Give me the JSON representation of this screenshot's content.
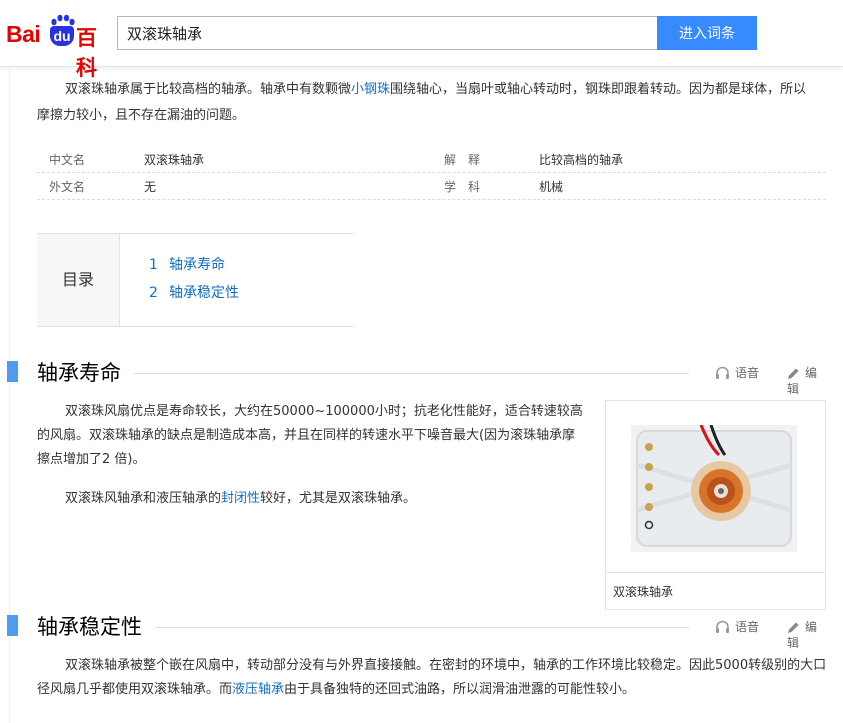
{
  "header": {
    "logo_bai": "Bai",
    "logo_du": "du",
    "logo_baike": "百科",
    "search_value": "双滚珠轴承",
    "search_button": "进入词条"
  },
  "intro": {
    "text_before": "双滚珠轴承属于比较高档的轴承。轴承中有数颗微",
    "link": "小钢珠",
    "text_after": "围绕轴心，当扇叶或轴心转动时，钢珠即跟着转动。因为都是球体，所以摩擦力较小，且不存在漏油的问题。"
  },
  "basic_info": {
    "row1": {
      "k1": "中文名",
      "v1": "双滚珠轴承",
      "k2": "解　释",
      "v2": "比较高档的轴承"
    },
    "row2": {
      "k1": "外文名",
      "v1": "无",
      "k2": "学　科",
      "v2": "机械"
    }
  },
  "catalog": {
    "title": "目录",
    "items": [
      {
        "num": "1",
        "label": "轴承寿命"
      },
      {
        "num": "2",
        "label": "轴承稳定性"
      }
    ]
  },
  "actions": {
    "voice": "语音",
    "edit": "编辑"
  },
  "section1": {
    "title": "轴承寿命",
    "para1": "双滚珠风扇优点是寿命较长，大约在50000~100000小时；抗老化性能好，适合转速较高的风扇。双滚珠轴承的缺点是制造成本高，并且在同样的转速水平下噪音最大(因为滚珠轴承摩擦点增加了2 倍)。",
    "para2_before": "双滚珠风轴承和液压轴承的",
    "para2_link": "封闭性",
    "para2_after": "较好，尤其是双滚珠轴承。"
  },
  "figure": {
    "caption": "双滚珠轴承"
  },
  "section2": {
    "title": "轴承稳定性",
    "para_before": "双滚珠轴承被整个嵌在风扇中，转动部分没有与外界直接接触。在密封的环境中，轴承的工作环境比较稳定。因此5000转级别的大口径风扇几乎都使用双滚珠轴承。而",
    "para_link": "液压轴承",
    "para_after": "由于具备独特的还回式油路，所以润滑油泄露的可能性较小。"
  },
  "colors": {
    "brand_red": "#e10602",
    "brand_blue": "#2932e1",
    "accent": "#388bff",
    "link": "#136ec2",
    "section_bar": "#4f9cee"
  }
}
